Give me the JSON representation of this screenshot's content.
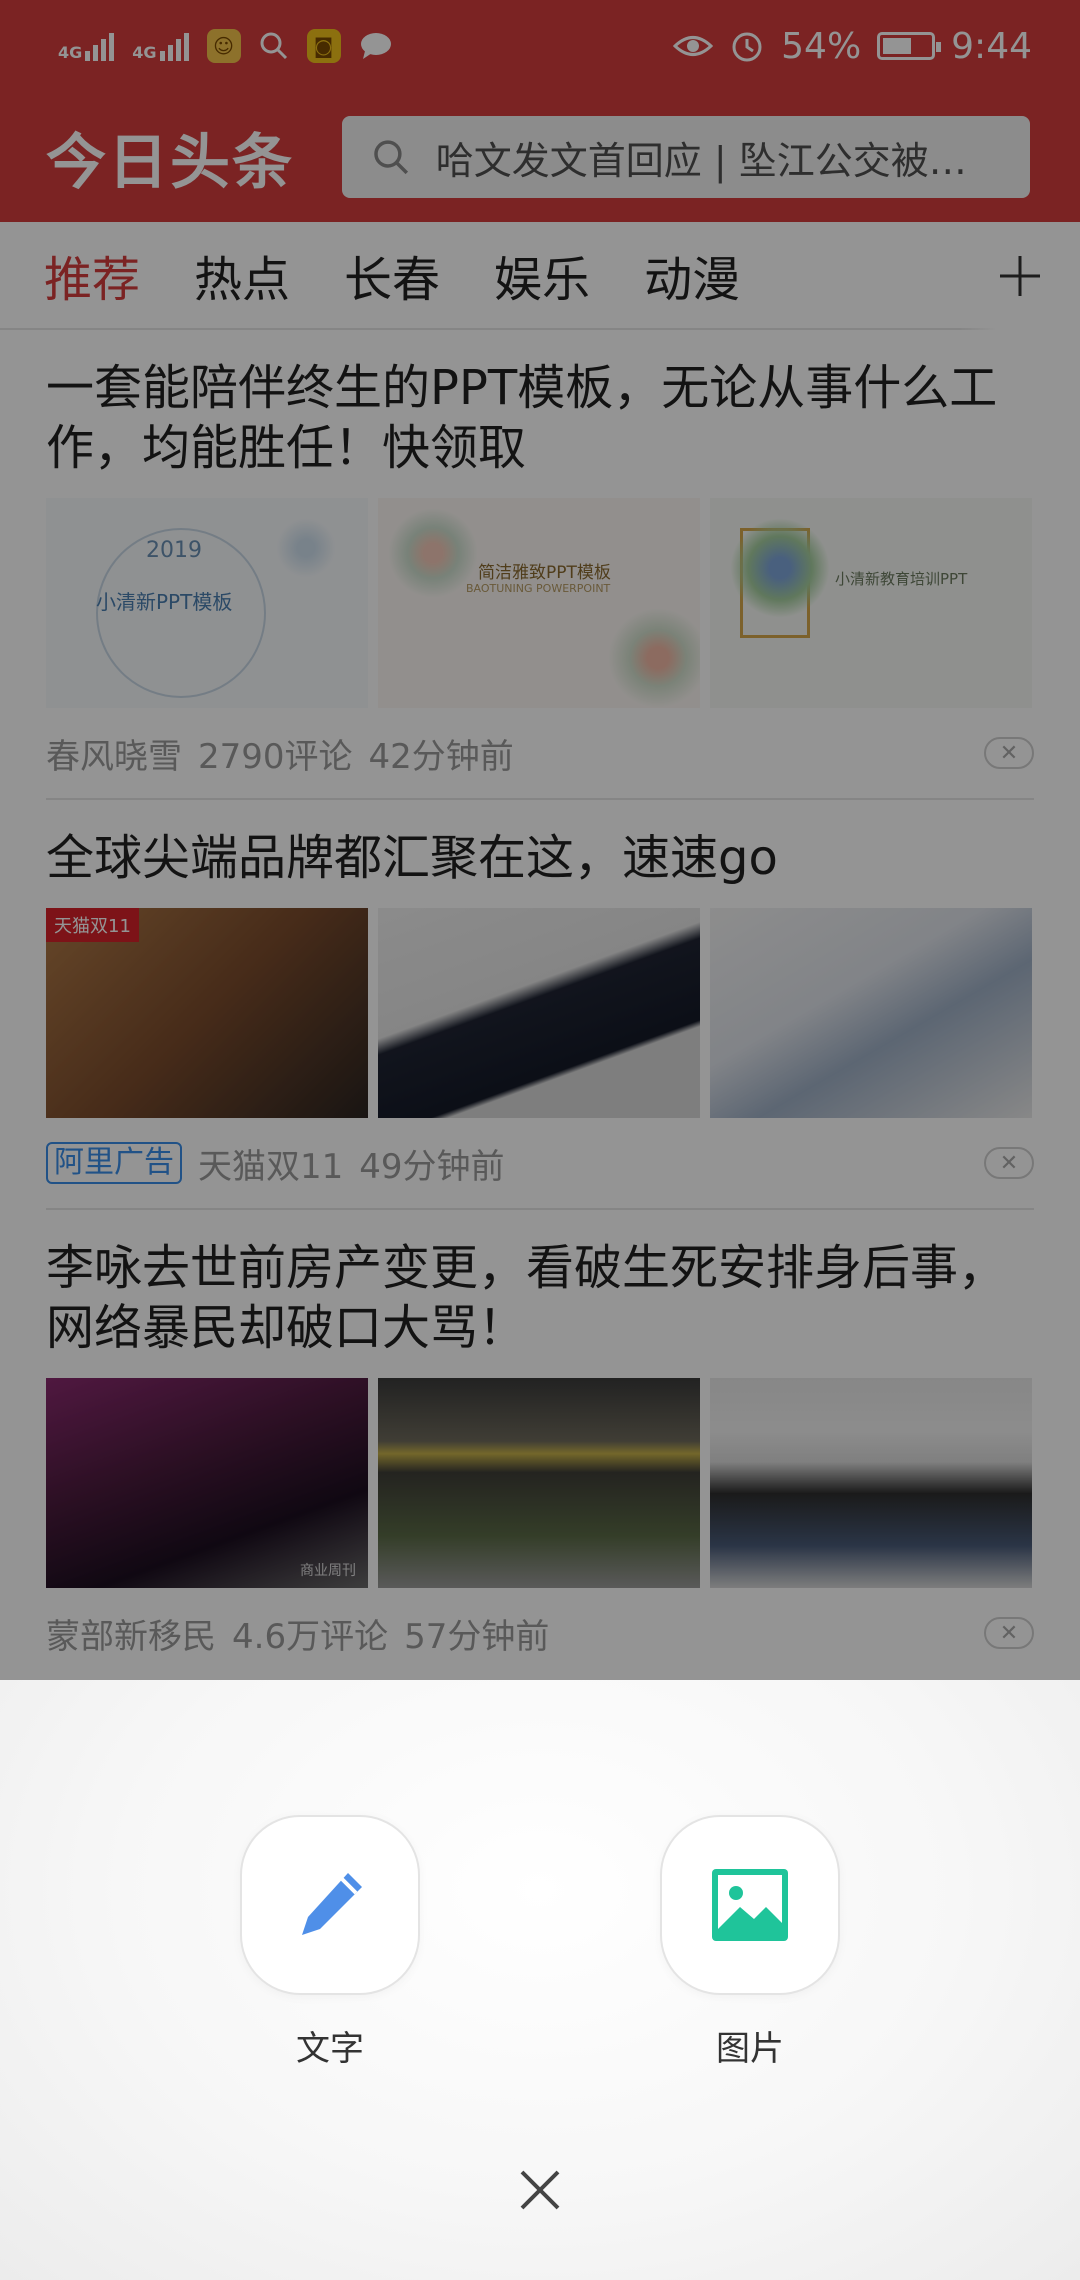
{
  "status_bar": {
    "net1": "4G",
    "net2": "4G",
    "battery": "54%",
    "time": "9:44",
    "icons": [
      "signal-icon",
      "signal-icon",
      "app-notification-icon",
      "search-icon",
      "car-icon",
      "chat-bubble-icon",
      "eye-icon",
      "alarm-icon",
      "battery-icon"
    ]
  },
  "header": {
    "logo": "今日头条",
    "search_text": "哈文发文首回应 | 坠江公交被打..."
  },
  "tabs": [
    "推荐",
    "热点",
    "长春",
    "娱乐",
    "动漫"
  ],
  "feed": [
    {
      "title": "一套能陪伴终生的PPT模板，无论从事什么工作，均能胜任！快领取",
      "source": "春风晓雪",
      "comments": "2790评论",
      "time": "42分钟前",
      "thumbs": [
        {
          "caption": "小清新PPT模板",
          "year": "2019"
        },
        {
          "caption": "简洁雅致PPT模板",
          "sub": "BAOTUNING POWERPOINT"
        },
        {
          "caption": "小清新教育培训PPT"
        }
      ]
    },
    {
      "title": "全球尖端品牌都汇聚在这，速速go",
      "ad_badge": "阿里广告",
      "source": "天猫双11",
      "time": "49分钟前",
      "thumb_badge": "天猫双11"
    },
    {
      "title": "李咏去世前房产变更，看破生死安排身后事，网络暴民却破口大骂！",
      "source": "蒙部新移民",
      "comments": "4.6万评论",
      "time": "57分钟前",
      "thumb_watermark": "商业周刊"
    }
  ],
  "sheet": {
    "options": [
      {
        "label": "文字",
        "icon": "pencil-icon",
        "color": "#4f8fe8"
      },
      {
        "label": "图片",
        "icon": "image-icon",
        "color": "#1fc49a"
      }
    ],
    "close_icon": "close-icon"
  },
  "colors": {
    "brand_red": "#d43d3d",
    "ad_blue": "#3a8ee8"
  }
}
